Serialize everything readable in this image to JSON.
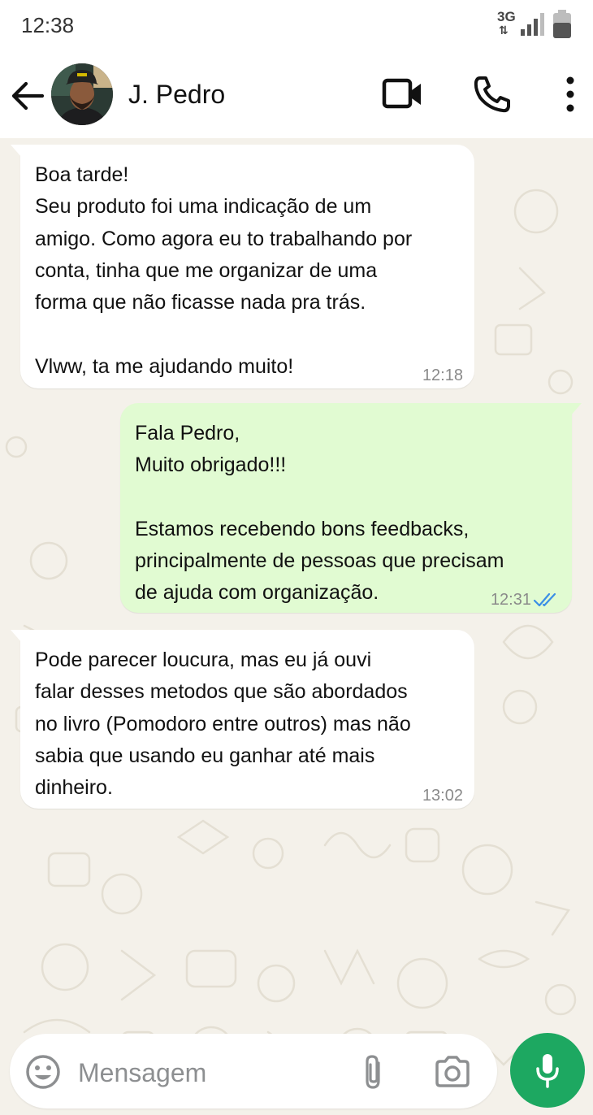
{
  "status_bar": {
    "time": "12:38",
    "network_type": "3G",
    "network_arrows": "⇅"
  },
  "header": {
    "contact_name": "J. Pedro",
    "icons": [
      "back-arrow-icon",
      "avatar",
      "video-call-icon",
      "phone-icon",
      "more-options-icon"
    ]
  },
  "messages": [
    {
      "direction": "incoming",
      "text": "Boa tarde!\nSeu produto foi uma indicação de um\namigo. Como agora eu to trabalhando por\nconta, tinha que me organizar de uma\nforma que não ficasse nada pra trás.\n\nVlww, ta me ajudando muito!",
      "time": "12:18"
    },
    {
      "direction": "outgoing",
      "text": "Fala Pedro,\nMuito obrigado!!!\n\nEstamos recebendo bons feedbacks,\nprincipalmente de pessoas que precisam\nde ajuda com organização.",
      "time": "12:31",
      "status": "read"
    },
    {
      "direction": "incoming",
      "text": "Pode parecer loucura, mas eu já ouvi\nfalar desses metodos que são abordados\nno livro (Pomodoro entre outros) mas não\nsabia que usando eu ganhar até mais\ndinheiro.",
      "time": "13:02"
    }
  ],
  "composer": {
    "placeholder": "Mensagem",
    "value": "",
    "icons": [
      "emoji-icon",
      "attach-icon",
      "camera-icon",
      "microphone-icon"
    ]
  },
  "colors": {
    "chat_background": "#f4f1ea",
    "incoming_bubble": "#ffffff",
    "outgoing_bubble": "#e1fbd2",
    "read_ticks": "#3a8ee6",
    "mic_button": "#1da861",
    "timestamp": "#8a8a8a"
  }
}
